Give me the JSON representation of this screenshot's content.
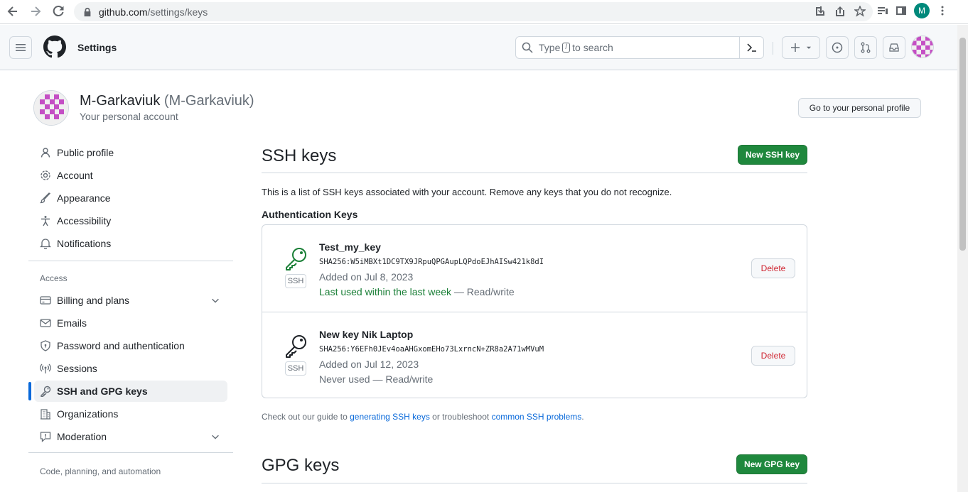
{
  "browser": {
    "url_host": "github.com",
    "url_path": "/settings/keys",
    "profile_initial": "M"
  },
  "header": {
    "title": "Settings",
    "search_prefix": "Type",
    "search_key": "/",
    "search_suffix": "to search"
  },
  "account": {
    "name": "M-Garkaviuk",
    "login": "(M-Garkaviuk)",
    "subtitle": "Your personal account",
    "profile_button": "Go to your personal profile"
  },
  "sidebar": {
    "items": [
      {
        "label": "Public profile",
        "icon": "person-icon"
      },
      {
        "label": "Account",
        "icon": "gear-icon"
      },
      {
        "label": "Appearance",
        "icon": "paintbrush-icon"
      },
      {
        "label": "Accessibility",
        "icon": "accessibility-icon"
      },
      {
        "label": "Notifications",
        "icon": "bell-icon"
      }
    ],
    "access_heading": "Access",
    "access_items": [
      {
        "label": "Billing and plans",
        "icon": "credit-card-icon"
      },
      {
        "label": "Emails",
        "icon": "mail-icon"
      },
      {
        "label": "Password and authentication",
        "icon": "shield-icon"
      },
      {
        "label": "Sessions",
        "icon": "broadcast-icon"
      },
      {
        "label": "SSH and GPG keys",
        "icon": "key-icon"
      },
      {
        "label": "Organizations",
        "icon": "organization-icon"
      },
      {
        "label": "Moderation",
        "icon": "report-icon"
      }
    ],
    "code_heading": "Code, planning, and automation"
  },
  "ssh": {
    "title": "SSH keys",
    "new_button": "New SSH key",
    "intro": "This is a list of SSH keys associated with your account. Remove any keys that you do not recognize.",
    "auth_heading": "Authentication Keys",
    "badge": "SSH",
    "delete_label": "Delete",
    "keys": [
      {
        "title": "Test_my_key",
        "fingerprint": "SHA256:W5iMBXt1DC9TX9JRpuQPGAupLQPdoEJhAISw421k8dI",
        "added": "Added on Jul 8, 2023",
        "used": "Last used within the last week",
        "access": "— Read/write",
        "status_color": "#1a7f37"
      },
      {
        "title": "New key Nik Laptop",
        "fingerprint": "SHA256:Y6EFh0JEv4oaAHGxomEHo73LxrncN+ZR8a2A71wMVuM",
        "added": "Added on Jul 12, 2023",
        "used": "Never used",
        "access": "— Read/write",
        "status_color": "#1f2328"
      }
    ],
    "guide_prefix": "Check out our guide to",
    "guide_link1": "generating SSH keys",
    "guide_mid": "or troubleshoot",
    "guide_link2": "common SSH problems",
    "guide_suffix": "."
  },
  "gpg": {
    "title": "GPG keys",
    "new_button": "New GPG key"
  },
  "colors": {
    "primary_green": "#1f883d",
    "link_blue": "#0969da",
    "danger_red": "#cf222e",
    "active_bar": "#0969da"
  }
}
